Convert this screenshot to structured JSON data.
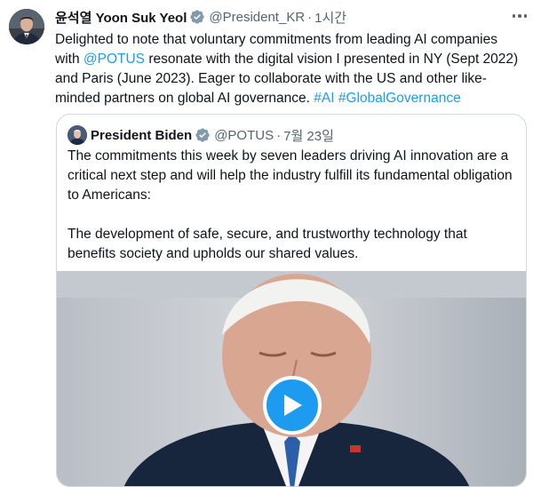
{
  "tweet": {
    "author_name": "윤석열 Yoon Suk Yeol",
    "handle": "@President_KR",
    "separator": "·",
    "time": "1시간",
    "text_before_mention": "Delighted to note that voluntary commitments from leading AI companies with ",
    "mention": "@POTUS",
    "text_after_mention": " resonate with the digital vision I presented in NY (Sept 2022) and Paris (June 2023). Eager to collaborate with the US and other like-minded partners on global AI governance. ",
    "hashtag_1": "#AI",
    "hashtag_2": "#GlobalGovernance",
    "verified_icon": "verified-badge",
    "more_icon": "more-horizontal"
  },
  "quoted_tweet": {
    "author_name": "President Biden",
    "handle": "@POTUS",
    "separator": "·",
    "date": "7월 23일",
    "paragraph_1": "The commitments this week by seven leaders driving AI innovation are a critical next step and will help the industry fulfill its fundamental obligation to Americans:",
    "paragraph_2": "The development of safe, secure, and trustworthy technology that benefits society and upholds our shared values.",
    "media_type": "video",
    "play_icon": "play-icon"
  },
  "colors": {
    "link": "#1d9bf0",
    "verified": "#829aab",
    "text": "#0f1419",
    "secondary_text": "#536471",
    "border": "#cfd9de"
  }
}
